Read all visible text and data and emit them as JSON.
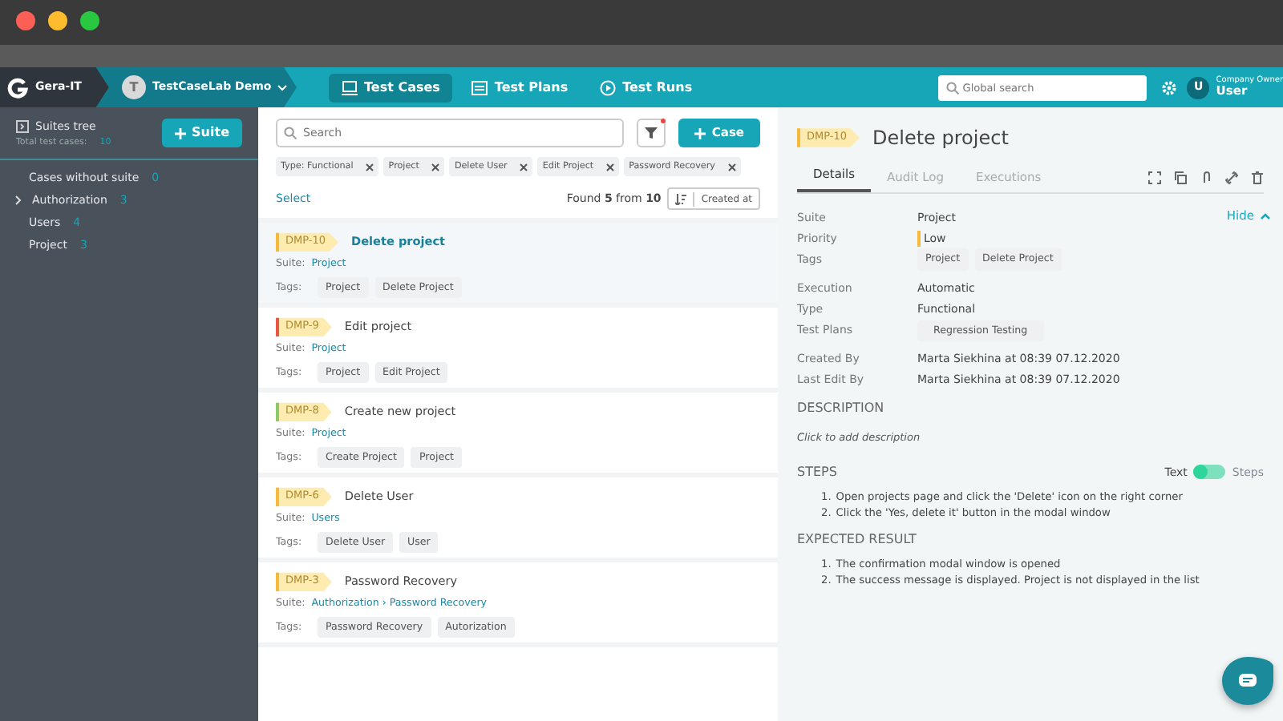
{
  "header": {
    "org": "Gera-IT",
    "project": {
      "initial": "T",
      "name": "TestCaseLab Demo"
    },
    "nav": [
      {
        "label": "Test Cases",
        "selected": true,
        "kind": "cases"
      },
      {
        "label": "Test Plans",
        "selected": false,
        "kind": "plans"
      },
      {
        "label": "Test Runs",
        "selected": false,
        "kind": "runs"
      }
    ],
    "search": {
      "placeholder": "Global search"
    },
    "user": {
      "initial": "U",
      "role": "Company Owner",
      "name": "User"
    }
  },
  "sidebar": {
    "title": "Suites tree",
    "total_label": "Total test cases:",
    "total": "10",
    "add_button": "Suite",
    "items": [
      {
        "label": "Cases without suite",
        "count": "0",
        "expandable": false
      },
      {
        "label": "Authorization",
        "count": "3",
        "expandable": true,
        "expanded": false
      },
      {
        "label": "Users",
        "count": "4",
        "expandable": false
      },
      {
        "label": "Project",
        "count": "3",
        "expandable": false
      }
    ]
  },
  "cases": {
    "search": {
      "placeholder": "Search"
    },
    "filter_active": true,
    "add_button": "Case",
    "filters": [
      "Type: Functional",
      "Project",
      "Delete User",
      "Edit Project",
      "Password Recovery"
    ],
    "select_link": "Select",
    "found": {
      "prefix": "Found",
      "count": "5",
      "middle": "from",
      "total": "10"
    },
    "sort": "Created at",
    "items": [
      {
        "id": "DMP-10",
        "title": "Delete project",
        "color": "#f6b93b",
        "selected": true,
        "suite_label": "Suite:",
        "suite": "Project",
        "tags_label": "Tags:",
        "tags": [
          "Project",
          "Delete Project"
        ]
      },
      {
        "id": "DMP-9",
        "title": "Edit project",
        "color": "#ea5545",
        "selected": false,
        "suite_label": "Suite:",
        "suite": "Project",
        "tags_label": "Tags:",
        "tags": [
          "Project",
          "Edit Project"
        ]
      },
      {
        "id": "DMP-8",
        "title": "Create new project",
        "color": "#8bc96b",
        "selected": false,
        "suite_label": "Suite:",
        "suite": "Project",
        "tags_label": "Tags:",
        "tags": [
          "Create Project",
          "Project"
        ]
      },
      {
        "id": "DMP-6",
        "title": "Delete User",
        "color": "#f6b93b",
        "selected": false,
        "suite_label": "Suite:",
        "suite": "Users",
        "tags_label": "Tags:",
        "tags": [
          "Delete User",
          "User"
        ]
      },
      {
        "id": "DMP-3",
        "title": "Password Recovery",
        "color": "#f6b93b",
        "selected": false,
        "suite_label": "Suite:",
        "suite": "Authorization › Password Recovery",
        "tags_label": "Tags:",
        "tags": [
          "Password Recovery",
          "Autorization"
        ]
      }
    ]
  },
  "detail": {
    "id": "DMP-10",
    "color": "#f6b93b",
    "title": "Delete project",
    "tabs": [
      {
        "label": "Details",
        "selected": true
      },
      {
        "label": "Audit Log",
        "selected": false
      },
      {
        "label": "Executions",
        "selected": false
      }
    ],
    "hide_link": "Hide",
    "field_groups": [
      [
        {
          "label": "Suite",
          "kind": "text",
          "value": "Project"
        },
        {
          "label": "Priority",
          "kind": "priority",
          "value": "Low",
          "color": "#f6b93b"
        },
        {
          "label": "Tags",
          "kind": "tags",
          "values": [
            "Project",
            "Delete Project"
          ]
        }
      ],
      [
        {
          "label": "Execution",
          "kind": "text",
          "value": "Automatic"
        },
        {
          "label": "Type",
          "kind": "text",
          "value": "Functional"
        },
        {
          "label": "Test Plans",
          "kind": "tags",
          "values": [
            "Regression Testing"
          ]
        }
      ],
      [
        {
          "label": "Created By",
          "kind": "text",
          "value": "Marta Siekhina at 08:39 07.12.2020"
        },
        {
          "label": "Last Edit By",
          "kind": "text",
          "value": "Marta Siekhina at 08:39 07.12.2020"
        }
      ]
    ],
    "description": {
      "heading": "DESCRIPTION",
      "placeholder": "Click to add description"
    },
    "steps": {
      "heading": "STEPS",
      "toggle": {
        "left": "Text",
        "right": "Steps",
        "on": false
      },
      "items": [
        {
          "number": "1.",
          "text": "Open projects page and click the 'Delete' icon on the right corner"
        },
        {
          "number": "2.",
          "text": "Click the 'Yes, delete it' button in the modal window"
        }
      ]
    },
    "expected": {
      "heading": "EXPECTED RESULT",
      "items": [
        {
          "number": "1.",
          "text": "The confirmation modal window is opened"
        },
        {
          "number": "2.",
          "text": "The success message is displayed. Project is not displayed in the list"
        }
      ]
    }
  }
}
